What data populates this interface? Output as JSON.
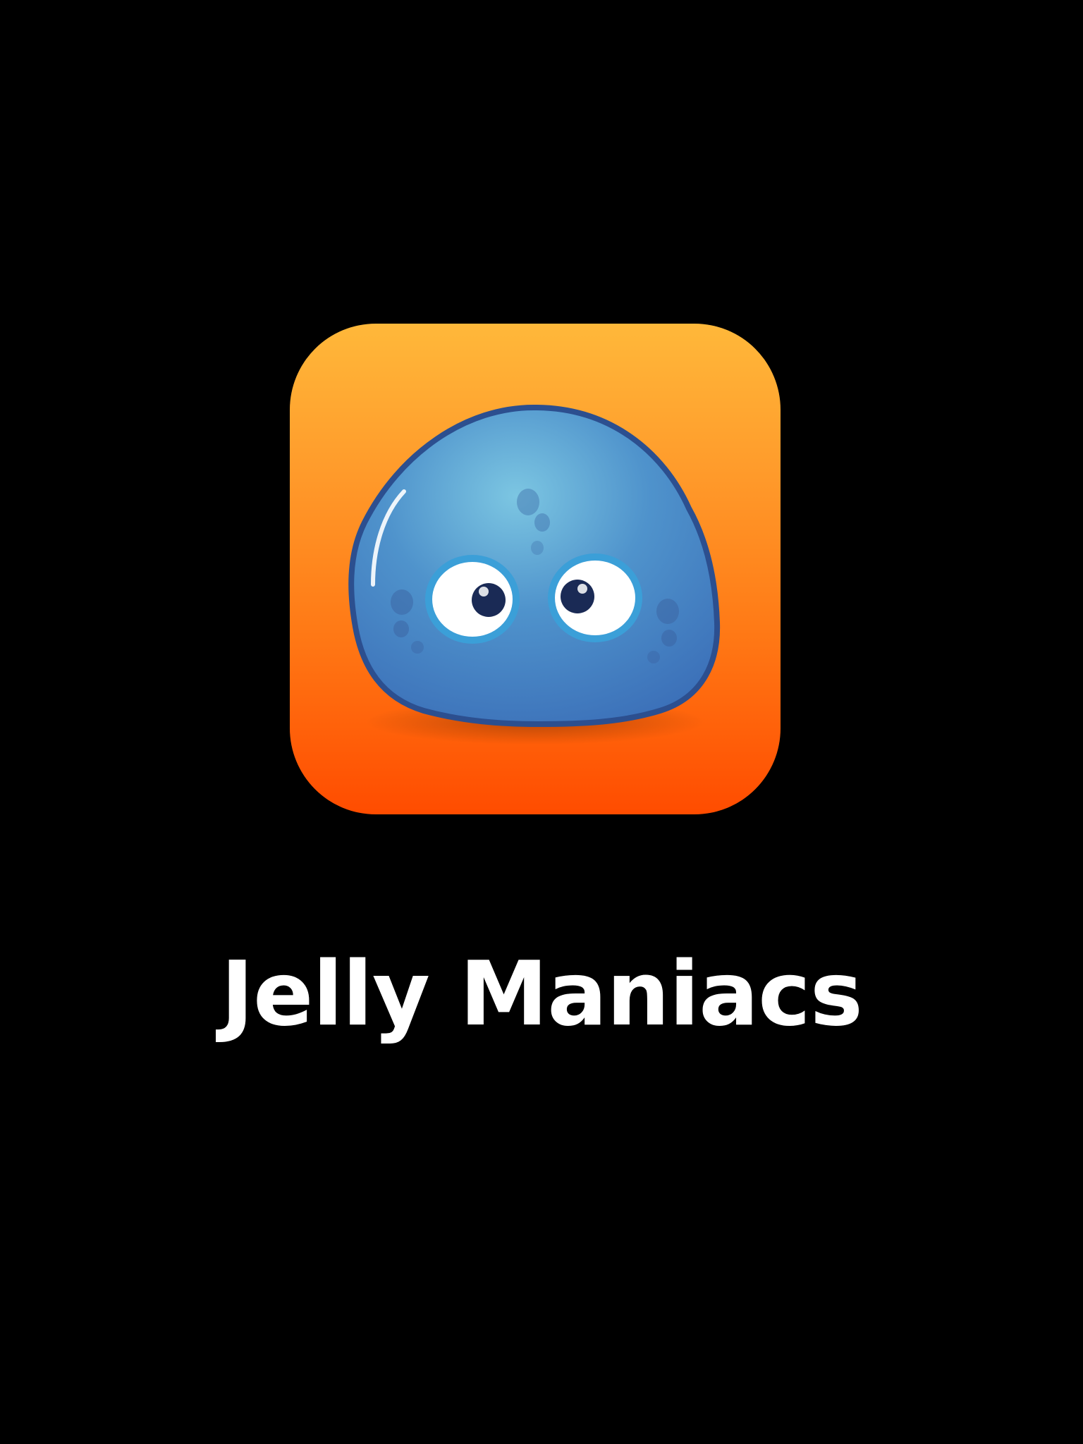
{
  "app": {
    "title": "Jelly Maniacs",
    "icon": "jelly-blob-icon"
  },
  "colors": {
    "background": "#000000",
    "icon_gradient_top": "#ffb83a",
    "icon_gradient_bottom": "#ff4c00",
    "jelly_blue": "#4a86c6",
    "title_text": "#ffffff"
  }
}
